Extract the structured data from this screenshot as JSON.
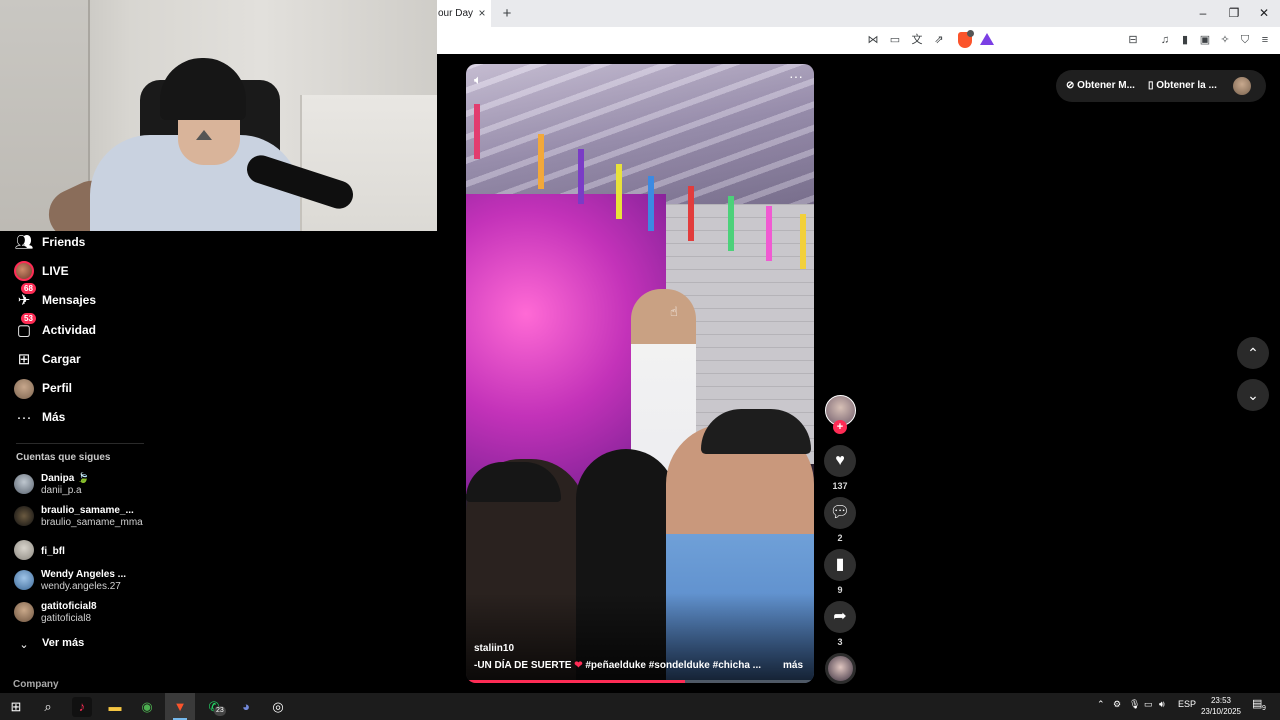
{
  "browser": {
    "tab_title": "our Day",
    "tab_close": "×",
    "new_tab": "+",
    "window_controls": [
      "–",
      "❐",
      "✕"
    ]
  },
  "sidebar": {
    "nav": [
      {
        "label": "Friends",
        "icon": "friends-icon"
      },
      {
        "label": "LIVE",
        "icon": "live-avatar"
      },
      {
        "label": "Mensajes",
        "icon": "messages-icon",
        "badge": "68"
      },
      {
        "label": "Actividad",
        "icon": "activity-icon",
        "badge": "53"
      },
      {
        "label": "Cargar",
        "icon": "upload-icon"
      },
      {
        "label": "Perfil",
        "icon": "profile-avatar"
      },
      {
        "label": "Más",
        "icon": "more-icon"
      }
    ],
    "following_title": "Cuentas que sigues",
    "following": [
      {
        "name": "Danipa 🍃",
        "handle": "danii_p.a"
      },
      {
        "name": "braulio_samame_...",
        "handle": "braulio_samame_mma"
      },
      {
        "name": "fi_bfl",
        "handle": ""
      },
      {
        "name": "Wendy Angeles ...",
        "handle": "wendy.angeles.27"
      },
      {
        "name": "gatitoficial8",
        "handle": "gatitoficial8"
      }
    ],
    "see_more": "Ver más",
    "company": "Company"
  },
  "video": {
    "username": "staliin10",
    "caption_pre": "-UN DÍA DE SUERTE ",
    "caption_heart": "❤",
    "caption_tags": "#peñaelduke #sondelduke #chicha ...",
    "more_label": "más",
    "progress": 0.63
  },
  "actions": {
    "likes": "137",
    "comments": "2",
    "saves": "9",
    "shares": "3"
  },
  "top_right": {
    "get_coins": "Obtener M...",
    "get_app": "Obtener la ..."
  },
  "taskbar": {
    "whatsapp_badge": "23",
    "lang": "ESP",
    "time": "23:53",
    "date": "23/10/2025",
    "notifications": "9"
  },
  "colors": {
    "accent": "#fe2c55",
    "background": "#000000",
    "button_bg": "#2f2f2f"
  }
}
